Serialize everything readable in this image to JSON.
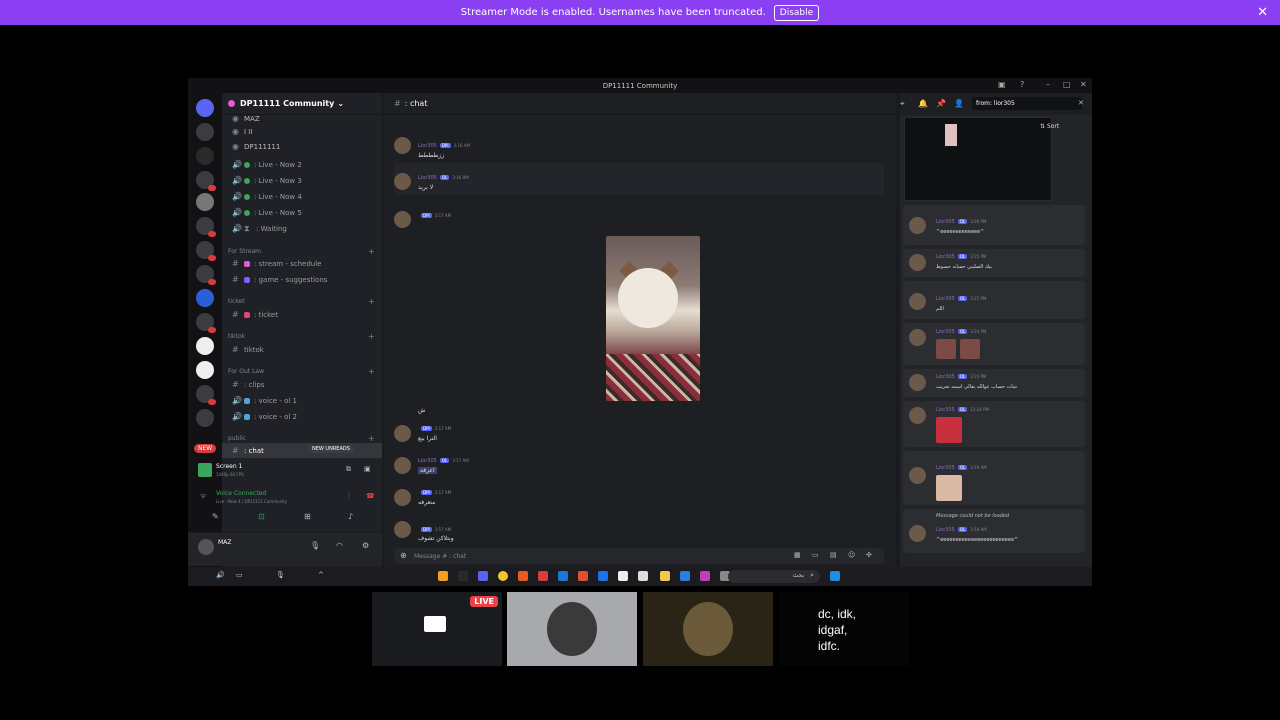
{
  "banner": {
    "text": "Streamer Mode is enabled. Usernames have been truncated.",
    "button": "Disable"
  },
  "window": {
    "title": "DP11111 Community"
  },
  "server": {
    "name": "DP11111 Community"
  },
  "sidebar": {
    "top_users": [
      "MAZ",
      "I II",
      "DP111111"
    ],
    "voice": [
      ": Live - Now 2",
      ": Live - Now 3",
      ": Live - Now 4",
      ": Live - Now 5",
      ": Waiting"
    ],
    "cat_stream": "For Stream",
    "ch_schedule": ": stream - schedule",
    "ch_suggestions": ": game - suggestions",
    "cat_ticket": "ticket",
    "ch_ticket": ": ticket",
    "cat_tiktok": "tiktok",
    "ch_tiktok": "tiktok",
    "cat_outlaw": "For Out Law",
    "ch_clips": ": clips",
    "ch_voice1": ": voice - ol 1",
    "ch_voice2": ": voice - ol 2",
    "cat_public": "public",
    "ch_chat": ": chat",
    "new_badge": "NEW",
    "new_unreads": "NEW UNREADS"
  },
  "voice_panel": {
    "screen": "Screen 1",
    "screen_sub": "1440p 60 FPS",
    "status": "Voice Connected",
    "status_sub": "Live - Now 4 / DP11111 Community"
  },
  "user": {
    "name": "MAZ"
  },
  "chat": {
    "channel": ": chat",
    "placeholder": "Message # : chat",
    "messages": [
      {
        "name": "Lior305",
        "badge": "DPI",
        "time": "3:16 AM",
        "text": "ززطططط"
      },
      {
        "name": "Lior305",
        "badge": "OL",
        "time": "3:16 AM",
        "text": "لا بريد"
      },
      {
        "name": "",
        "badge": "DPI",
        "time": "3:17 AM",
        "text": ""
      },
      {
        "name": "",
        "badge": "",
        "time": "",
        "text": "ش"
      },
      {
        "name": "",
        "badge": "DPI",
        "time": "3:17 AM",
        "text": "الترا بيع"
      },
      {
        "name": "Lior305",
        "badge": "OL",
        "time": "3:17 AM",
        "text": "اعرفه"
      },
      {
        "name": "",
        "badge": "DPI",
        "time": "3:17 AM",
        "text": "متعرفه"
      },
      {
        "name": "",
        "badge": "DPI",
        "time": "3:17 AM",
        "text": "وبتلاكن تشوف"
      }
    ]
  },
  "search": {
    "query": "from: lior305",
    "sort": "Sort",
    "results": [
      {
        "name": "Lior305",
        "badge": "OL",
        "time": "3:26 PM",
        "text": "^eeeeeeeeeeeee^"
      },
      {
        "name": "Lior305",
        "badge": "OL",
        "time": "3:25 PM",
        "text": "بيك الصليبي حسابه حسوط"
      },
      {
        "name": "Lior305",
        "badge": "OL",
        "time": "3:25 PM",
        "text": "اللم"
      },
      {
        "name": "Lior305",
        "badge": "OL",
        "time": "3:24 PM",
        "text": ""
      },
      {
        "name": "Lior305",
        "badge": "OL",
        "time": "3:24 PM",
        "text": "شات حساب عوالله يقالي اسمه تجريب"
      },
      {
        "name": "Lior305",
        "badge": "OL",
        "time": "12:24 PM",
        "text": ""
      },
      {
        "name": "Lior305",
        "badge": "OL",
        "time": "3:19 AM",
        "text": ""
      },
      {
        "name": "Lior305",
        "badge": "OL",
        "time": "3:18 AM",
        "text": "^eeeeeeeeeeeeeeeeeeeeeeee^"
      }
    ],
    "not_loaded": "Message could not be loaded"
  },
  "taskbar": {
    "search": "بحث"
  },
  "streams": {
    "live": "LIVE",
    "idk_lines": [
      "dc, idk,",
      "idgaf,",
      "idfc."
    ]
  }
}
